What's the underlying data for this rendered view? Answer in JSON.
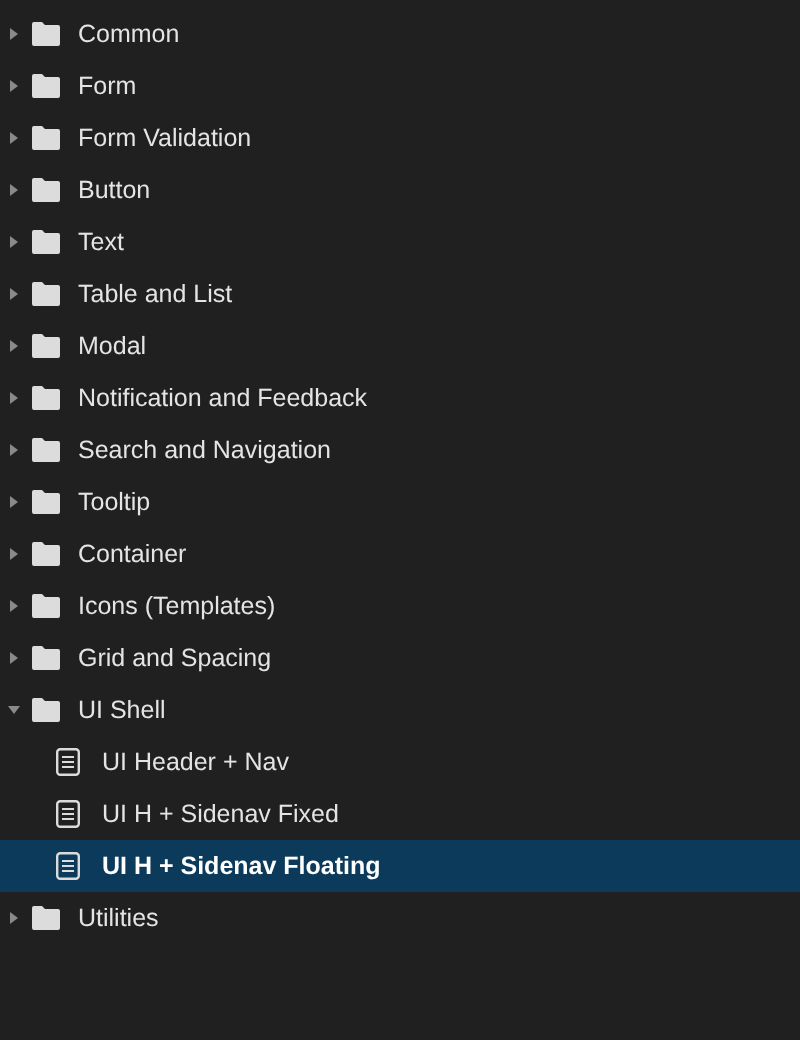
{
  "tree": [
    {
      "kind": "folder",
      "label": "Common",
      "expanded": false
    },
    {
      "kind": "folder",
      "label": "Form",
      "expanded": false
    },
    {
      "kind": "folder",
      "label": "Form Validation",
      "expanded": false
    },
    {
      "kind": "folder",
      "label": "Button",
      "expanded": false
    },
    {
      "kind": "folder",
      "label": "Text",
      "expanded": false
    },
    {
      "kind": "folder",
      "label": "Table and List",
      "expanded": false
    },
    {
      "kind": "folder",
      "label": "Modal",
      "expanded": false
    },
    {
      "kind": "folder",
      "label": "Notification and Feedback",
      "expanded": false
    },
    {
      "kind": "folder",
      "label": "Search and Navigation",
      "expanded": false
    },
    {
      "kind": "folder",
      "label": "Tooltip",
      "expanded": false
    },
    {
      "kind": "folder",
      "label": "Container",
      "expanded": false
    },
    {
      "kind": "folder",
      "label": "Icons (Templates)",
      "expanded": false
    },
    {
      "kind": "folder",
      "label": "Grid and Spacing",
      "expanded": false
    },
    {
      "kind": "folder",
      "label": "UI Shell",
      "expanded": true,
      "children": [
        {
          "kind": "page",
          "label": "UI Header + Nav",
          "selected": false
        },
        {
          "kind": "page",
          "label": "UI H + Sidenav Fixed",
          "selected": false
        },
        {
          "kind": "page",
          "label": "UI H + Sidenav Floating",
          "selected": true
        }
      ]
    },
    {
      "kind": "folder",
      "label": "Utilities",
      "expanded": false
    }
  ]
}
